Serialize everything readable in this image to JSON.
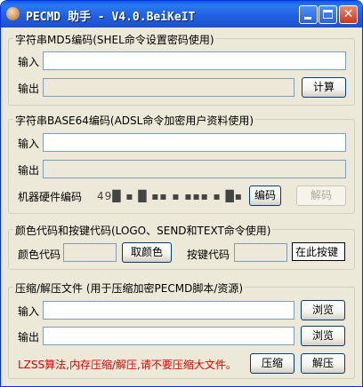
{
  "window": {
    "title": "PECMD 助手 - V4.0.BeiKeIT"
  },
  "md5": {
    "legend": "字符串MD5编码(SHEL命令设置密码使用)",
    "input_label": "输入",
    "input_value": "",
    "output_label": "输出",
    "output_value": "",
    "calc_button": "计算"
  },
  "base64": {
    "legend": "字符串BASE64编码(ADSL命令加密用户资料使用)",
    "input_label": "输入",
    "input_value": "",
    "output_label": "输出",
    "output_value": "",
    "hw_label": "机器硬件编码",
    "hw_value": "49█ ▪ █ ▪▪ ▪ ▪▪▪ ▪ █▪",
    "encode_button": "编码",
    "decode_button": "解码"
  },
  "color": {
    "legend": "颜色代码和按键代码(LOGO、SEND和TEXT命令使用)",
    "color_label": "颜色代码",
    "color_value": "",
    "pick_button": "取颜色",
    "key_label": "按键代码",
    "key_value": "",
    "press_button": "在此按键"
  },
  "compress": {
    "legend": "压缩/解压文件 (用于压缩加密PECMD脚本/资源)",
    "input_label": "输入",
    "input_value": "",
    "output_label": "输出",
    "output_value": "",
    "browse_button_1": "浏览",
    "browse_button_2": "浏览",
    "note": "LZSS算法,内存压缩/解压,请不要压缩大文件。",
    "compress_button": "压缩",
    "decompress_button": "解压"
  }
}
